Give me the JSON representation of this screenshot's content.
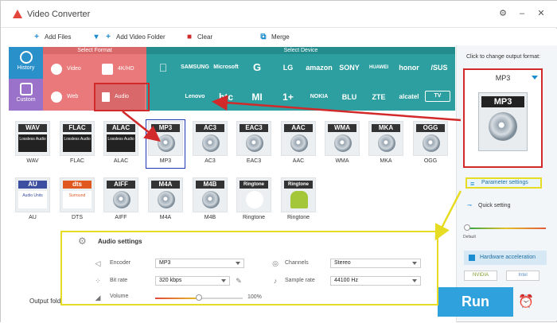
{
  "app": {
    "title": "Video Converter"
  },
  "window_controls": {
    "settings_icon": "gear-icon",
    "minimize": "–",
    "close": "✕"
  },
  "toolbar": {
    "add_files": "Add Files",
    "add_video_folder": "Add Video Folder",
    "clear": "Clear",
    "merge": "Merge"
  },
  "categories": {
    "format": "Select Format",
    "device": "Select Device"
  },
  "nav": [
    {
      "label": "History",
      "icon": "clock-icon"
    },
    {
      "label": "Custom",
      "icon": "user-icon"
    }
  ],
  "format_types": [
    {
      "label": "Video",
      "icon": "play-icon"
    },
    {
      "label": "4K/HD",
      "icon": "4k-icon"
    },
    {
      "label": "Web",
      "icon": "chrome-icon"
    },
    {
      "label": "Audio",
      "icon": "speaker-icon"
    }
  ],
  "brands": {
    "row1": [
      "",
      "SAMSUNG",
      "Microsoft",
      "G",
      "LG",
      "amazon",
      "SONY",
      "HUAWEI",
      "honor",
      "/SUS"
    ],
    "row2": [
      "",
      "Lenovo",
      "htc",
      "MI",
      "1+",
      "NOKIA",
      "BLU",
      "ZTE",
      "alcatel",
      "TV"
    ]
  },
  "formats_row1": [
    {
      "tag": "WAV",
      "sub": "Lossless Audio",
      "label": "WAV"
    },
    {
      "tag": "FLAC",
      "sub": "Lossless Audio",
      "label": "FLAC"
    },
    {
      "tag": "ALAC",
      "sub": "Lossless Audio",
      "label": "ALAC"
    },
    {
      "tag": "MP3",
      "sub": "",
      "label": "MP3"
    },
    {
      "tag": "AC3",
      "sub": "",
      "label": "AC3"
    },
    {
      "tag": "EAC3",
      "sub": "",
      "label": "EAC3"
    },
    {
      "tag": "AAC",
      "sub": "",
      "label": "AAC"
    },
    {
      "tag": "WMA",
      "sub": "",
      "label": "WMA"
    },
    {
      "tag": "MKA",
      "sub": "",
      "label": "MKA"
    },
    {
      "tag": "OGG",
      "sub": "",
      "label": "OGG"
    }
  ],
  "formats_row2": [
    {
      "tag": "AU",
      "sub": "Audio Units",
      "label": "AU"
    },
    {
      "tag": "dts",
      "sub": "Surround",
      "label": "DTS"
    },
    {
      "tag": "AIFF",
      "sub": "",
      "label": "AIFF"
    },
    {
      "tag": "M4A",
      "sub": "",
      "label": "M4A"
    },
    {
      "tag": "M4B",
      "sub": "",
      "label": "M4B"
    },
    {
      "tag": "Ringtone",
      "sub": "",
      "label": "Ringtone"
    },
    {
      "tag": "Ringtone",
      "sub": "",
      "label": "Ringtone"
    }
  ],
  "right": {
    "hint": "Click to change output format:",
    "selected": "MP3",
    "icon_tag": "MP3",
    "parameter_settings": "Parameter settings",
    "quick_setting": "Quick setting",
    "default": "Default",
    "hardware_acceleration": "Hardware acceleration",
    "gpu_nvidia": "NVIDIA",
    "gpu_intel": "Intel"
  },
  "audio_settings": {
    "title": "Audio settings",
    "encoder_label": "Encoder",
    "encoder_value": "MP3",
    "channels_label": "Channels",
    "channels_value": "Stereo",
    "bitrate_label": "Bit rate",
    "bitrate_value": "320 kbps",
    "samplerate_label": "Sample rate",
    "samplerate_value": "44100 Hz",
    "volume_label": "Volume",
    "volume_value": "100%",
    "volume_fraction": 0.5
  },
  "bottom": {
    "output_folder": "Output folde",
    "run": "Run"
  },
  "colors": {
    "format_bg": "#e9797a",
    "device_bg": "#2e9fa0",
    "run_bg": "#2fa1dd",
    "highlight_red": "#d22a2a",
    "highlight_yellow": "#e6dc23"
  }
}
